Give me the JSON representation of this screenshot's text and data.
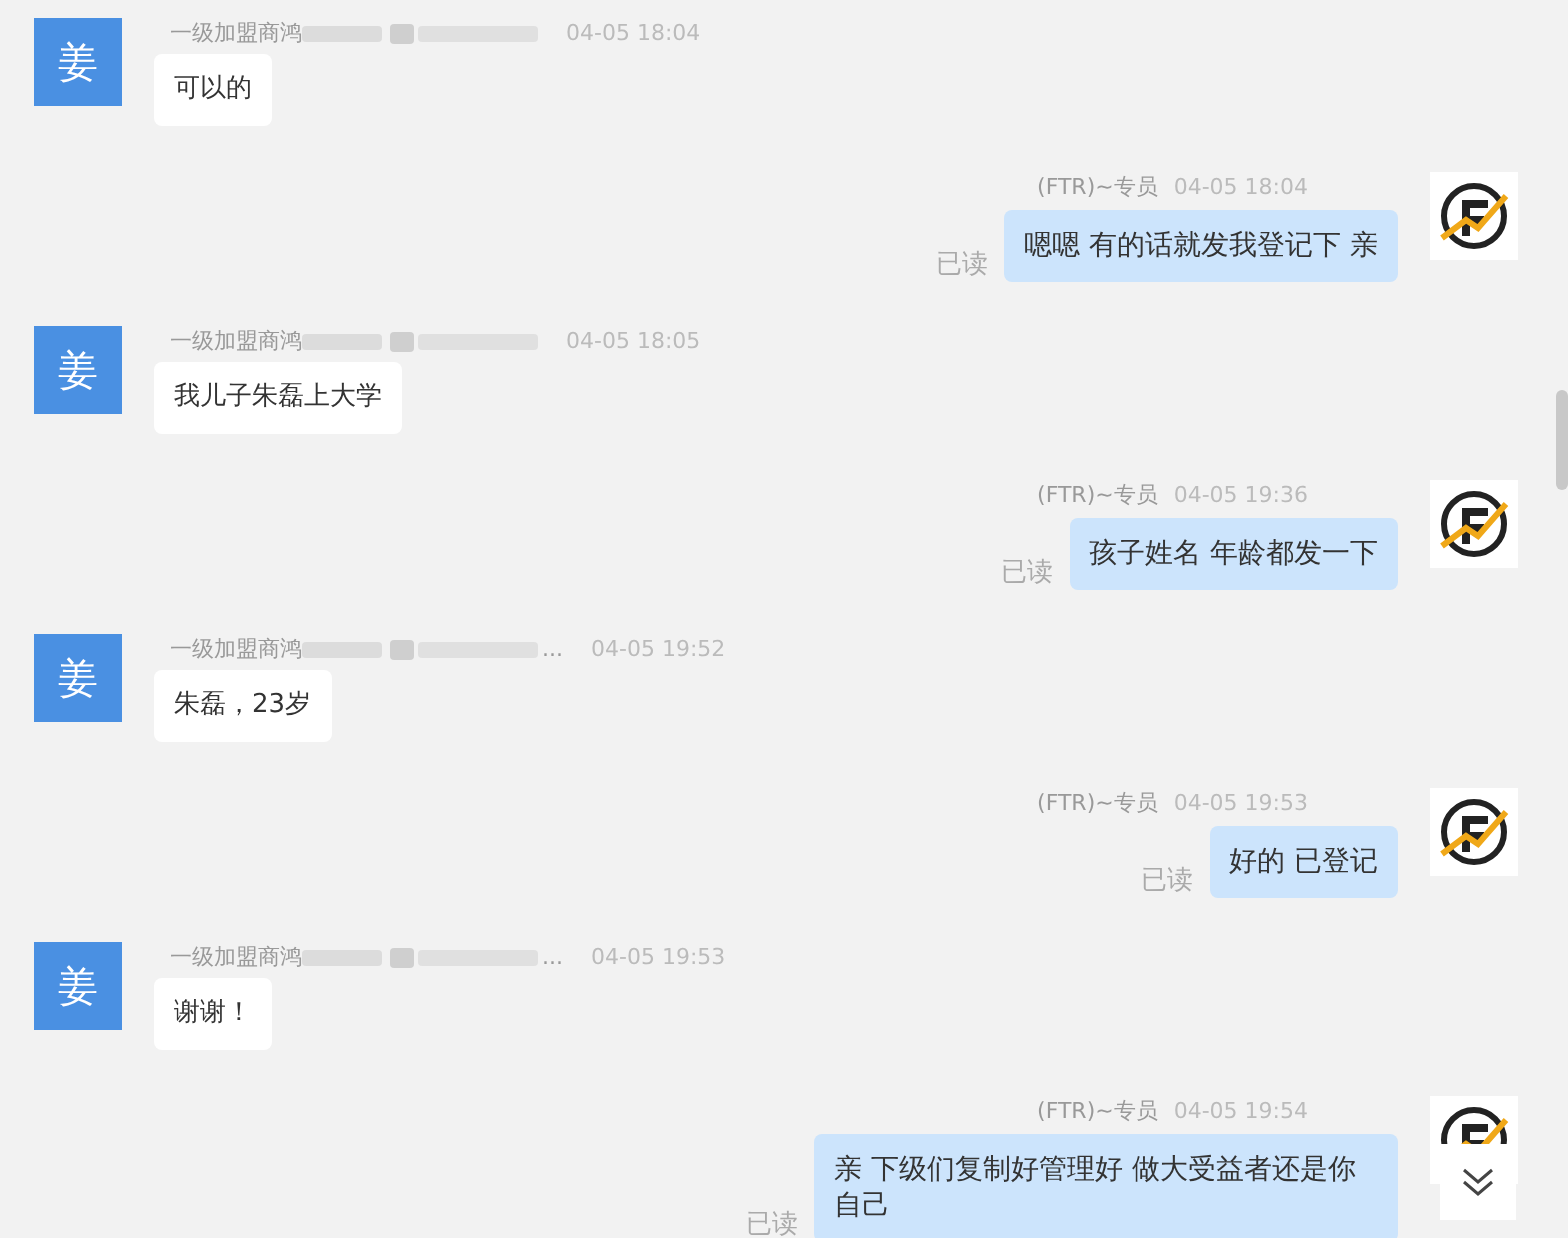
{
  "messages": [
    {
      "kind": "received",
      "avatar": "姜",
      "name": "一级加盟商鸿",
      "time": "04-05 18:04",
      "text": "可以的"
    },
    {
      "kind": "sent",
      "name": "(FTR)~专员",
      "time": "04-05 18:04",
      "text": "嗯嗯 有的话就发我登记下 亲",
      "status": "已读"
    },
    {
      "kind": "received",
      "avatar": "姜",
      "name": "一级加盟商鸿",
      "time": "04-05 18:05",
      "text": "我儿子朱磊上大学"
    },
    {
      "kind": "sent",
      "name": "(FTR)~专员",
      "time": "04-05 19:36",
      "text": "孩子姓名 年龄都发一下",
      "status": "已读"
    },
    {
      "kind": "received",
      "avatar": "姜",
      "name": "一级加盟商鸿",
      "ellipsis": "...",
      "time": "04-05 19:52",
      "text": "朱磊，23岁"
    },
    {
      "kind": "sent",
      "name": "(FTR)~专员",
      "time": "04-05 19:53",
      "text": "好的 已登记",
      "status": "已读"
    },
    {
      "kind": "received",
      "avatar": "姜",
      "name": "一级加盟商鸿",
      "ellipsis": "...",
      "time": "04-05 19:53",
      "text": "谢谢！"
    },
    {
      "kind": "sent",
      "name": "(FTR)~专员",
      "time": "04-05 19:54",
      "text": "亲 下级们复制好管理好 做大受益者还是你自己",
      "status": "已读"
    }
  ]
}
